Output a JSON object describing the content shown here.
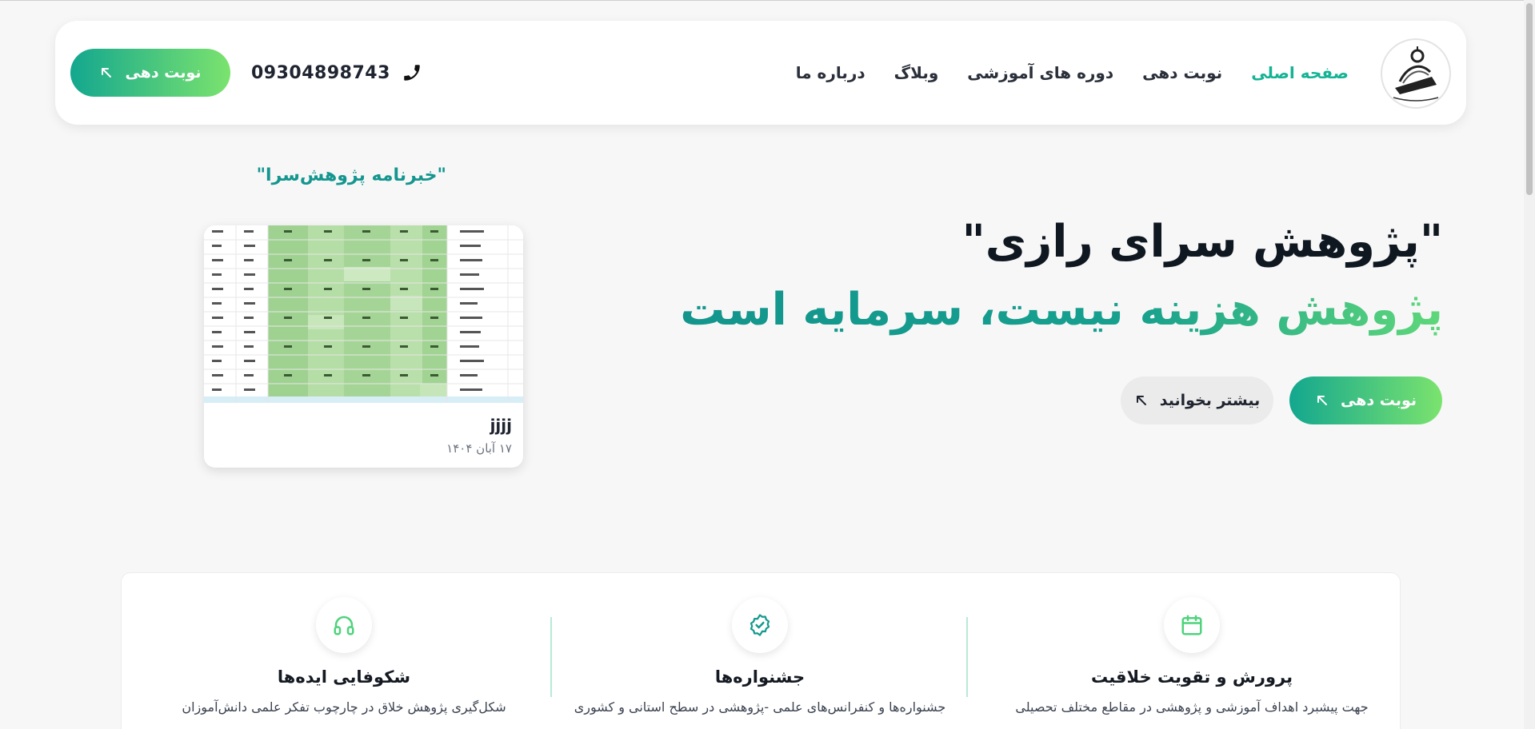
{
  "header": {
    "nav": [
      {
        "label": "صفحه اصلی",
        "active": true
      },
      {
        "label": "نوبت دهی",
        "active": false
      },
      {
        "label": "دوره های آموزشی",
        "active": false
      },
      {
        "label": "وبلاگ",
        "active": false
      },
      {
        "label": "درباره ما",
        "active": false
      }
    ],
    "phone": "09304898743",
    "cta_label": "نوبت دهی"
  },
  "hero": {
    "title_line1": "\"پژوهش سرای رازی\"",
    "title_line2": "پژوهش هزینه نیست، سرمایه است",
    "primary_label": "نوبت دهی",
    "secondary_label": "بیشتر بخوانید"
  },
  "newsletter": {
    "heading": "\"خبرنامه پژوهش‌سرا\"",
    "card_title": "jjjj",
    "card_date": "۱۷ آبان ۱۴۰۴"
  },
  "features": [
    {
      "title": "پرورش و تقویت خلاقیت",
      "desc": "جهت پیشبرد اهداف آموزشی و پژوهشی در مقاطع مختلف تحصیلی",
      "icon": "calendar-icon"
    },
    {
      "title": "جشنواره‌ها",
      "desc": "جشنواره‌ها و کنفرانس‌های علمی -پژوهشی در سطح استانی و کشوری",
      "icon": "badge-check-icon"
    },
    {
      "title": "شکوفایی ایده‌ها",
      "desc": "شکل‌گیری پژوهش خلاق در چارچوب تفکر علمی دانش‌آموزان",
      "icon": "headphones-icon"
    }
  ],
  "colors": {
    "accent": "#14b394",
    "gradient_start": "#13a78f",
    "gradient_end": "#7be36e"
  }
}
